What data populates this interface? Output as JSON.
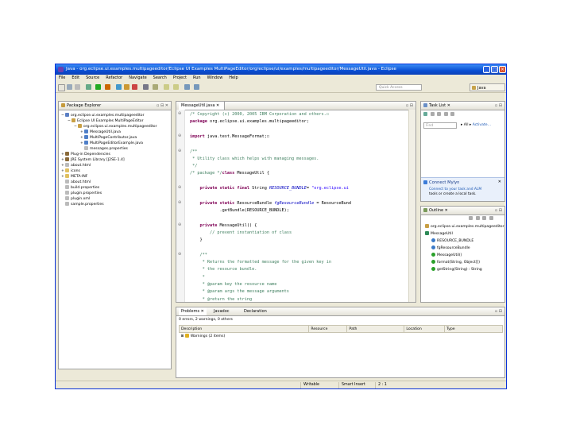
{
  "window": {
    "title": "Java - org.eclipse.ui.examples.multipageeditor/Eclipse UI Examples MultiPageEditor/org/eclipse/ui/examples/multipageeditor/MessageUtil.java - Eclipse"
  },
  "menu": [
    "File",
    "Edit",
    "Source",
    "Refactor",
    "Navigate",
    "Search",
    "Project",
    "Run",
    "Window",
    "Help"
  ],
  "toolbar": {
    "quick_access_placeholder": "Quick Access",
    "perspective_label": "Java"
  },
  "package_explorer": {
    "tab": "Package Explorer",
    "items": [
      {
        "indent": 0,
        "exp": "−",
        "label": "org.eclipse.ui.examples.multipageeditor",
        "icon": "project"
      },
      {
        "indent": 1,
        "exp": "−",
        "label": "Eclipse UI Examples MultiPageEditor",
        "icon": "src"
      },
      {
        "indent": 2,
        "exp": "−",
        "label": "org.eclipse.ui.examples.multipageeditor",
        "icon": "pkg"
      },
      {
        "indent": 3,
        "exp": "+",
        "label": "MessageUtil.java",
        "icon": "java"
      },
      {
        "indent": 3,
        "exp": "+",
        "label": "MultiPageContributor.java",
        "icon": "java"
      },
      {
        "indent": 3,
        "exp": "+",
        "label": "MultiPageEditorExample.java",
        "icon": "java"
      },
      {
        "indent": 3,
        "exp": "",
        "label": "messages.properties",
        "icon": "file"
      },
      {
        "indent": 0,
        "exp": "+",
        "label": "Plug-in Dependencies",
        "icon": "lib"
      },
      {
        "indent": 0,
        "exp": "+",
        "label": "JRE System Library [J2SE-1.4]",
        "icon": "lib"
      },
      {
        "indent": 0,
        "exp": "+",
        "label": "about.html",
        "icon": "file"
      },
      {
        "indent": 0,
        "exp": "+",
        "label": "icons",
        "icon": "folder"
      },
      {
        "indent": 0,
        "exp": "+",
        "label": "META-INF",
        "icon": "folder"
      },
      {
        "indent": 0,
        "exp": "",
        "label": "about.html",
        "icon": "file"
      },
      {
        "indent": 0,
        "exp": "",
        "label": "build.properties",
        "icon": "file"
      },
      {
        "indent": 0,
        "exp": "",
        "label": "plugin.properties",
        "icon": "file"
      },
      {
        "indent": 0,
        "exp": "",
        "label": "plugin.xml",
        "icon": "file"
      },
      {
        "indent": 0,
        "exp": "",
        "label": "sample.properties",
        "icon": "file"
      }
    ]
  },
  "editor": {
    "tab": "MessageUtil.java",
    "lines": [
      [
        [
          "cm",
          "/* Copyright (c) 2000, 2005 IBM Corporation and others.☐"
        ]
      ],
      [
        [
          "kw",
          "package "
        ],
        [
          "",
          "org.eclipse.ui.examples.multipageeditor;"
        ]
      ],
      [
        [
          "",
          ""
        ]
      ],
      [
        [
          "kw",
          "import "
        ],
        [
          "",
          "java.text.MessageFormat;☐"
        ]
      ],
      [
        [
          "",
          ""
        ]
      ],
      [
        [
          "cm",
          "/**"
        ]
      ],
      [
        [
          "cm",
          " * Utility class which helps with managing messages."
        ]
      ],
      [
        [
          "cm",
          " */"
        ]
      ],
      [
        [
          "cm",
          "/* package */"
        ],
        [
          "kw",
          "class "
        ],
        [
          "",
          "MessageUtil {"
        ]
      ],
      [
        [
          "",
          ""
        ]
      ],
      [
        [
          "",
          "    "
        ],
        [
          "kw",
          "private static final "
        ],
        [
          "",
          "String "
        ],
        [
          "fd",
          "RESOURCE_BUNDLE"
        ],
        [
          "",
          "= "
        ],
        [
          "st",
          "\"org.eclipse.ui"
        ]
      ],
      [
        [
          "",
          ""
        ]
      ],
      [
        [
          "",
          "    "
        ],
        [
          "kw",
          "private static "
        ],
        [
          "",
          "ResourceBundle "
        ],
        [
          "fd",
          "fgResourceBundle"
        ],
        [
          "",
          "",
          " = ResourceBund"
        ]
      ],
      [
        [
          "",
          "            .getBundle(RESOURCE_BUNDLE);"
        ]
      ],
      [
        [
          "",
          ""
        ]
      ],
      [
        [
          "",
          "    "
        ],
        [
          "kw",
          "private "
        ],
        [
          "",
          "MessageUtil() {"
        ]
      ],
      [
        [
          "",
          "        "
        ],
        [
          "cm",
          "// prevent instantiation of class"
        ]
      ],
      [
        [
          "",
          "    }"
        ]
      ],
      [
        [
          "",
          ""
        ]
      ],
      [
        [
          "",
          "    "
        ],
        [
          "cm",
          "/**"
        ]
      ],
      [
        [
          "",
          "    "
        ],
        [
          "cm",
          " * Returns the formatted message for the given key in"
        ]
      ],
      [
        [
          "",
          "    "
        ],
        [
          "cm",
          " * the resource bundle."
        ]
      ],
      [
        [
          "",
          "    "
        ],
        [
          "cm",
          " *"
        ]
      ],
      [
        [
          "",
          "    "
        ],
        [
          "cm",
          " * @param key the resource name"
        ]
      ],
      [
        [
          "",
          "    "
        ],
        [
          "cm",
          " * @param args the message arguments"
        ]
      ],
      [
        [
          "",
          "    "
        ],
        [
          "cm",
          " * @return the string"
        ]
      ]
    ]
  },
  "tasklist": {
    "tab": "Task List",
    "find_placeholder": "Find",
    "filter_all": "All",
    "activate": "Activate..."
  },
  "mylyn": {
    "title": "Connect Mylyn",
    "line1": "Connect to your task and ALM",
    "line2": "tools or create a local task."
  },
  "outline": {
    "tab": "Outline",
    "items": [
      {
        "indent": 0,
        "label": "org.eclipse.ui.examples.multipageeditor",
        "icon": "pkg"
      },
      {
        "indent": 0,
        "label": "MessageUtil",
        "icon": "class"
      },
      {
        "indent": 1,
        "label": "RESOURCE_BUNDLE",
        "icon": "field"
      },
      {
        "indent": 1,
        "label": "fgResourceBundle",
        "icon": "field"
      },
      {
        "indent": 1,
        "label": "MessageUtil()",
        "icon": "method"
      },
      {
        "indent": 1,
        "label": "format(String, Object[])",
        "icon": "method"
      },
      {
        "indent": 1,
        "label": "getString(String) : String",
        "icon": "method"
      }
    ]
  },
  "problems": {
    "tabs": [
      "Problems",
      "Javadoc",
      "Declaration"
    ],
    "summary": "0 errors, 2 warnings, 0 others",
    "columns": [
      "Description",
      "Resource",
      "Path",
      "Location",
      "Type"
    ],
    "rows": [
      [
        "Warnings (2 items)",
        "",
        "",
        "",
        ""
      ]
    ]
  },
  "status": {
    "writable": "Writable",
    "insert": "Smart Insert",
    "position": "2 : 1"
  },
  "colors": {
    "titlebar": "#0a4fd4",
    "accent": "#3a8cf5",
    "keyword": "#7f0055",
    "comment": "#3f7f5f",
    "string": "#2a00ff"
  }
}
